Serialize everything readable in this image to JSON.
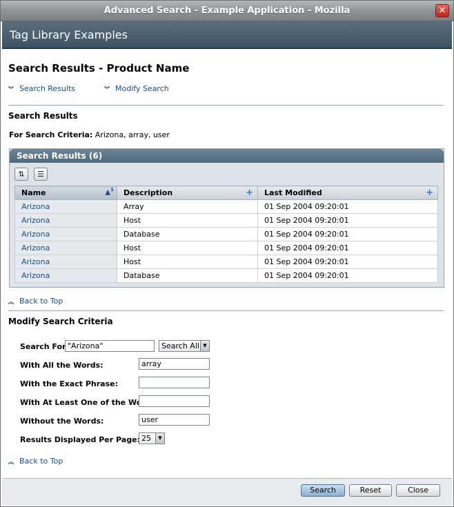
{
  "window": {
    "title": "Advanced Search - Example Application - Mozilla",
    "close_label": "✕"
  },
  "masthead": {
    "title": "Tag Library Examples"
  },
  "page": {
    "title": "Search Results - Product Name",
    "jumps": [
      "Search Results",
      "Modify Search"
    ]
  },
  "results": {
    "section_title": "Search Results",
    "criteria_label": "For Search Criteria:",
    "criteria_value": "Arizona, array, user",
    "table_title": "Search Results (6)",
    "columns": [
      "Name",
      "Description",
      "Last Modified"
    ],
    "sort_marker": "1",
    "rows": [
      {
        "name": "Arizona",
        "description": "Array",
        "modified": "01 Sep 2004 09:20:01"
      },
      {
        "name": "Arizona",
        "description": "Host",
        "modified": "01 Sep 2004 09:20:01"
      },
      {
        "name": "Arizona",
        "description": "Database",
        "modified": "01 Sep 2004 09:20:01"
      },
      {
        "name": "Arizona",
        "description": "Host",
        "modified": "01 Sep 2004 09:20:01"
      },
      {
        "name": "Arizona",
        "description": "Host",
        "modified": "01 Sep 2004 09:20:01"
      },
      {
        "name": "Arizona",
        "description": "Database",
        "modified": "01 Sep 2004 09:20:01"
      }
    ],
    "back_to_top": "Back to Top"
  },
  "modify": {
    "section_title": "Modify Search Criteria",
    "search_for_label": "Search For:",
    "search_for_value": "\"Arizona\"",
    "search_scope": "Search All",
    "all_words_label": "With All the Words:",
    "all_words_value": "array",
    "exact_phrase_label": "With the Exact Phrase:",
    "exact_phrase_value": "",
    "at_least_one_label": "With At Least One of the Words:",
    "at_least_one_value": "",
    "without_label": "Without the Words:",
    "without_value": "user",
    "per_page_label": "Results Displayed Per Page:",
    "per_page_value": "25",
    "back_to_top": "Back to Top"
  },
  "footer": {
    "search": "Search",
    "reset": "Reset",
    "close": "Close"
  },
  "colors": {
    "link": "#1a4a8a",
    "header": "#4f687b",
    "masthead": "#3e5465"
  }
}
